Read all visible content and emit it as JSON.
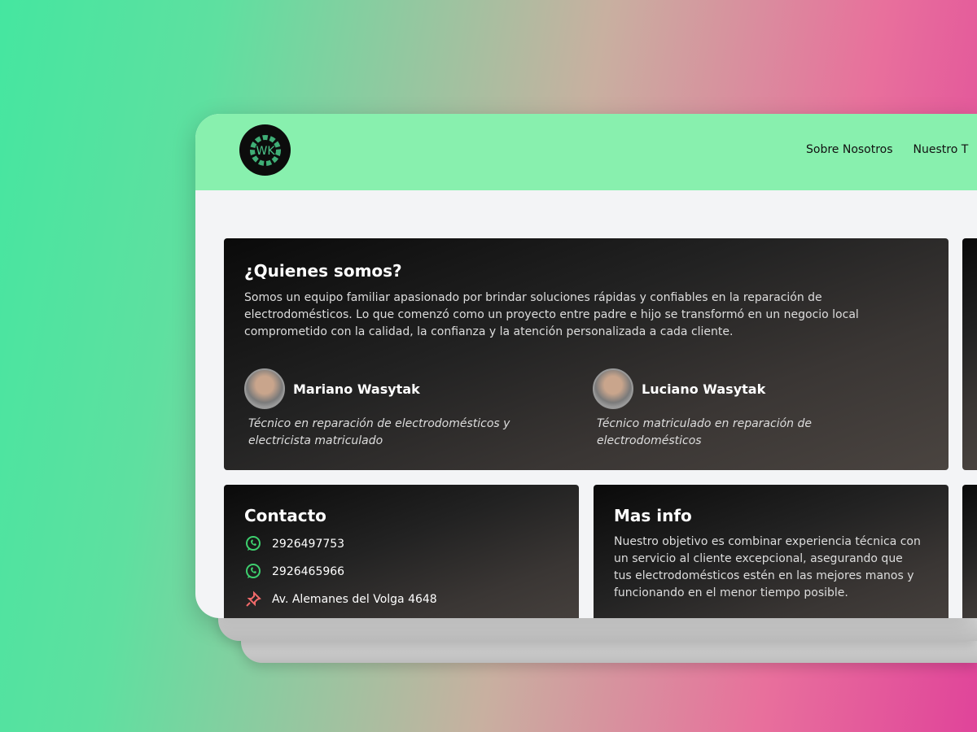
{
  "header": {
    "logo_text": "WK",
    "nav": [
      "Sobre Nosotros",
      "Nuestro T"
    ]
  },
  "about": {
    "title": "¿Quienes somos?",
    "text": "Somos un equipo familiar apasionado por brindar soluciones rápidas y confiables en la reparación de electrodomésticos. Lo que comenzó como un proyecto entre padre e hijo se transformó en un negocio local comprometido con la calidad, la confianza y la atención personalizada a cada cliente.",
    "people": [
      {
        "name": "Mariano Wasytak",
        "role": "Técnico en reparación de electrodomésticos y electricista matriculado"
      },
      {
        "name": "Luciano Wasytak",
        "role": "Técnico matriculado en reparación de electrodomésticos"
      }
    ]
  },
  "contact": {
    "title": "Contacto",
    "items": [
      {
        "icon": "whatsapp-icon",
        "text": "2926497753"
      },
      {
        "icon": "whatsapp-icon",
        "text": "2926465966"
      },
      {
        "icon": "pin-icon",
        "text": "Av. Alemanes del Volga 4648"
      }
    ]
  },
  "info": {
    "title": "Mas info",
    "text": "Nuestro objetivo es combinar experiencia técnica con un servicio al cliente excepcional, asegurando que tus electrodomésticos estén en las mejores manos y funcionando en el menor tiempo posible."
  },
  "colors": {
    "header": "#88f0ae",
    "whatsapp": "#3ecf6e",
    "pin": "#f06a6a"
  }
}
